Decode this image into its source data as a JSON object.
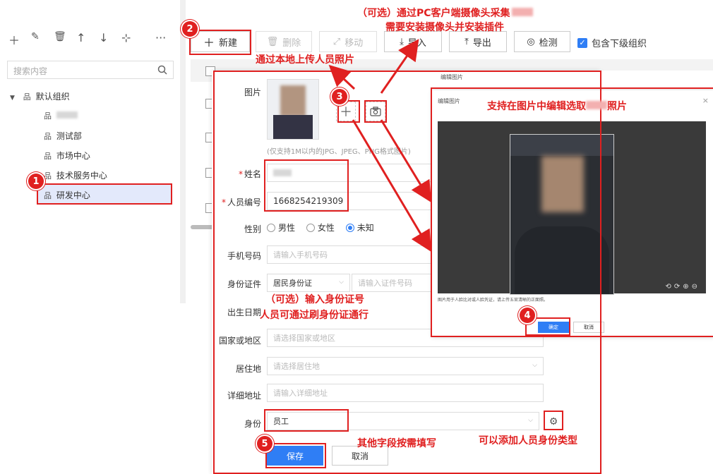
{
  "left_panel": {
    "toolbar_icons": [
      "plus-icon",
      "edit-icon",
      "trash-icon",
      "arrow-up-icon",
      "arrow-down-icon",
      "org-add-icon",
      "more-icon"
    ],
    "search_placeholder": "搜索内容",
    "tree": {
      "root": "默认组织",
      "children": [
        "",
        "测试部",
        "市场中心",
        "技术服务中心",
        "研发中心"
      ]
    }
  },
  "toolbar": {
    "new": "新建",
    "delete": "删除",
    "move": "移动",
    "import": "导入",
    "export": "导出",
    "detect": "检测",
    "include_sub": "包含下级组织"
  },
  "form": {
    "photo_label": "图片",
    "photo_hint": "(仅支持1M以内的JPG、JPEG、PNG格式图片)",
    "name_label": "姓名",
    "id_label": "人员编号",
    "id_value": "1668254219309",
    "gender_label": "性别",
    "gender_options": [
      "男性",
      "女性",
      "未知"
    ],
    "phone_label": "手机号码",
    "phone_placeholder": "请输入手机号码",
    "idcard_label": "身份证件",
    "idcard_type": "居民身份证",
    "idcard_placeholder": "请输入证件号码",
    "birth_label": "出生日期",
    "country_label": "国家或地区",
    "country_placeholder": "请选择国家或地区",
    "residence_label": "居住地",
    "residence_placeholder": "请选择居住地",
    "address_label": "详细地址",
    "address_placeholder": "请输入详细地址",
    "identity_label": "身份",
    "identity_value": "员工",
    "save": "保存",
    "cancel": "取消"
  },
  "editor": {
    "title": "编辑图片",
    "hint": "图片用于人脸比对或人脸凭证，请上传五官清晰的正面照。",
    "ok": "确定",
    "cancel": "取消"
  },
  "annotations": {
    "n1": "1",
    "n2": "2",
    "n3": "3",
    "n4": "4",
    "n5": "5",
    "camera_line1": "（可选）通过PC客户端摄像头采集",
    "camera_line2": "需要安装摄像头并安装插件",
    "upload_local": "通过本地上传人员照片",
    "edit_select": "支持在图片中编辑选取",
    "edit_select_tail": "照片",
    "idcard_line1": "（可选）输入身份证号",
    "idcard_line2": "人员可通过刷身份证通行",
    "other_fields": "其他字段按需填写",
    "add_identity": "可以添加人员身份类型"
  },
  "colors": {
    "accent": "#2f7ef5",
    "annotation": "#e02020"
  }
}
